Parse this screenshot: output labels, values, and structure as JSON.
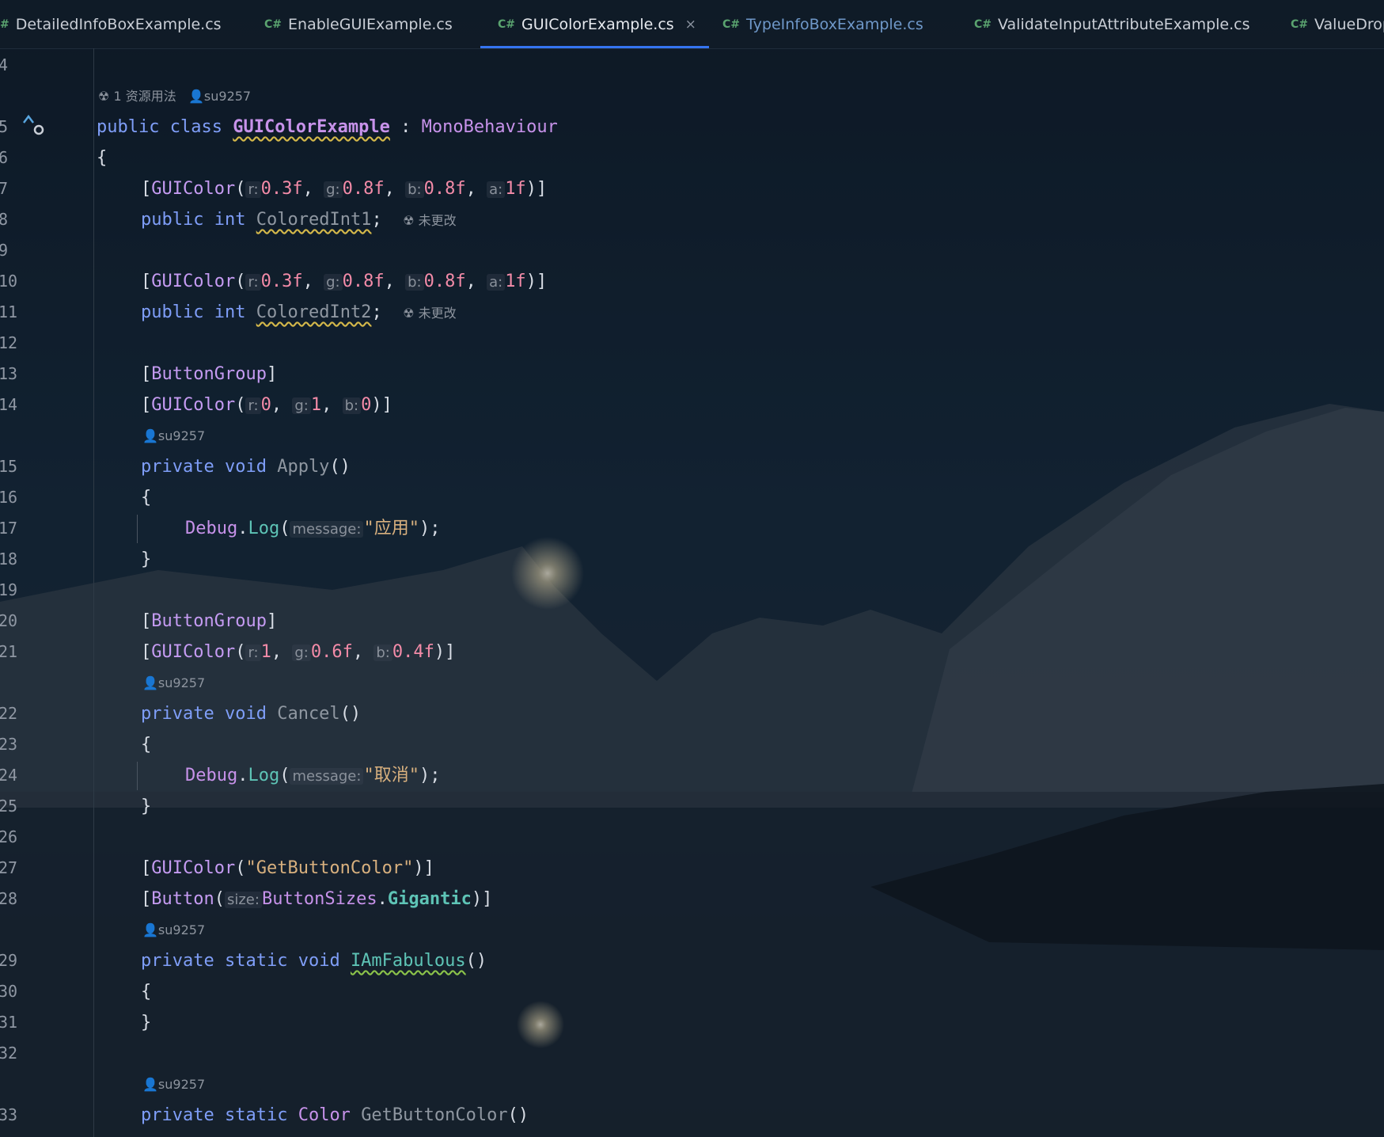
{
  "tabs": [
    {
      "label": "DetailedInfoBoxExample.cs",
      "lang": "#"
    },
    {
      "label": "EnableGUIExample.cs",
      "lang": "C#"
    },
    {
      "label": "GUIColorExample.cs",
      "lang": "C#",
      "close": "×"
    },
    {
      "label": "TypeInfoBoxExample.cs",
      "lang": "C#"
    },
    {
      "label": "ValidateInputAttributeExample.cs",
      "lang": "C#"
    },
    {
      "label": "ValueDrop",
      "lang": "C#"
    }
  ],
  "line_numbers": [
    "4",
    "5",
    "6",
    "7",
    "8",
    "9",
    "10",
    "11",
    "12",
    "13",
    "14",
    "15",
    "16",
    "17",
    "18",
    "19",
    "20",
    "21",
    "22",
    "23",
    "24",
    "25",
    "26",
    "27",
    "28",
    "29",
    "30",
    "31",
    "32",
    "33"
  ],
  "hints": {
    "usages": "1 资源用法",
    "author": "su9257",
    "unchanged": "未更改"
  },
  "code": {
    "public": "public",
    "class": "class",
    "class_name": "GUIColorExample",
    "colon": ":",
    "base": "MonoBehaviour",
    "open_brace": "{",
    "close_brace": "}",
    "attr_guicolor": "GUIColor",
    "attr_buttongroup": "ButtonGroup",
    "attr_button": "Button",
    "p_r": "r:",
    "p_g": "g:",
    "p_b": "b:",
    "p_a": "a:",
    "p_message": "message:",
    "p_size": "size:",
    "v03": "0.3f",
    "v08": "0.8f",
    "v1f": "1f",
    "v0": "0",
    "v1": "1",
    "v06": "0.6f",
    "v04": "0.4f",
    "int": "int",
    "field1": "ColoredInt1",
    "field2": "ColoredInt2",
    "private": "private",
    "void": "void",
    "static": "static",
    "apply": "Apply",
    "cancel": "Cancel",
    "debug": "Debug",
    "log": "Log",
    "msg_apply": "\"应用\"",
    "msg_cancel": "\"取消\"",
    "str_getbtn": "\"GetButtonColor\"",
    "buttonsizes": "ButtonSizes",
    "gigantic": "Gigantic",
    "fabulous": "IAmFabulous",
    "color": "Color",
    "getbuttoncolor": "GetButtonColor"
  }
}
